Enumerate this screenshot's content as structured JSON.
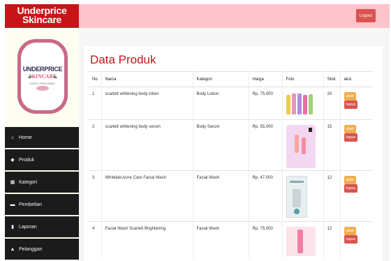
{
  "brand": {
    "line1": "Underprice",
    "line2": "Skincare"
  },
  "logo": {
    "line1": "UNDERPRICE",
    "line2": "SKINCARE",
    "line3": "100% ORIGINAL"
  },
  "header": {
    "logout_label": "Logout"
  },
  "sidebar": {
    "items": [
      {
        "label": "Home",
        "icon": "home-icon",
        "glyph": "⌂"
      },
      {
        "label": "Produk",
        "icon": "gift-icon",
        "glyph": "◆"
      },
      {
        "label": "Kategori",
        "icon": "grid-icon",
        "glyph": "▦"
      },
      {
        "label": "Pembelian",
        "icon": "cart-icon",
        "glyph": "▬"
      },
      {
        "label": "Laporan",
        "icon": "file-icon",
        "glyph": "▮"
      },
      {
        "label": "Pelanggan",
        "icon": "user-icon",
        "glyph": "▲"
      }
    ]
  },
  "main": {
    "title": "Data Produk",
    "columns": [
      "No",
      "Nama",
      "Kategori",
      "Harga",
      "Foto",
      "Stok",
      "aksi"
    ],
    "rows": [
      {
        "no": "1",
        "nama": "scarlett whitening body lotion",
        "kategori": "Body Lotion",
        "harga": "Rp. 75,000",
        "stok": "20"
      },
      {
        "no": "2",
        "nama": "scarlett whitening body serum",
        "kategori": "Body Serum",
        "harga": "Rp. 55,000",
        "stok": "15"
      },
      {
        "no": "3",
        "nama": "Whitelab Acne Care Facial Wash",
        "kategori": "Facial Wash",
        "harga": "Rp. 47,000",
        "stok": "12"
      },
      {
        "no": "4",
        "nama": "Facial Wash Scarlett Brightening",
        "kategori": "Facial Wash",
        "harga": "Rp. 75,000",
        "stok": "12"
      }
    ],
    "ubah_label": "ubah",
    "hapus_label": "hapus"
  },
  "colors": {
    "brand_red": "#c81419",
    "header_pink": "#ffc3cb",
    "sidebar_dark": "#1b1b1b",
    "warning": "#f0ad4e",
    "danger": "#d9534f"
  }
}
